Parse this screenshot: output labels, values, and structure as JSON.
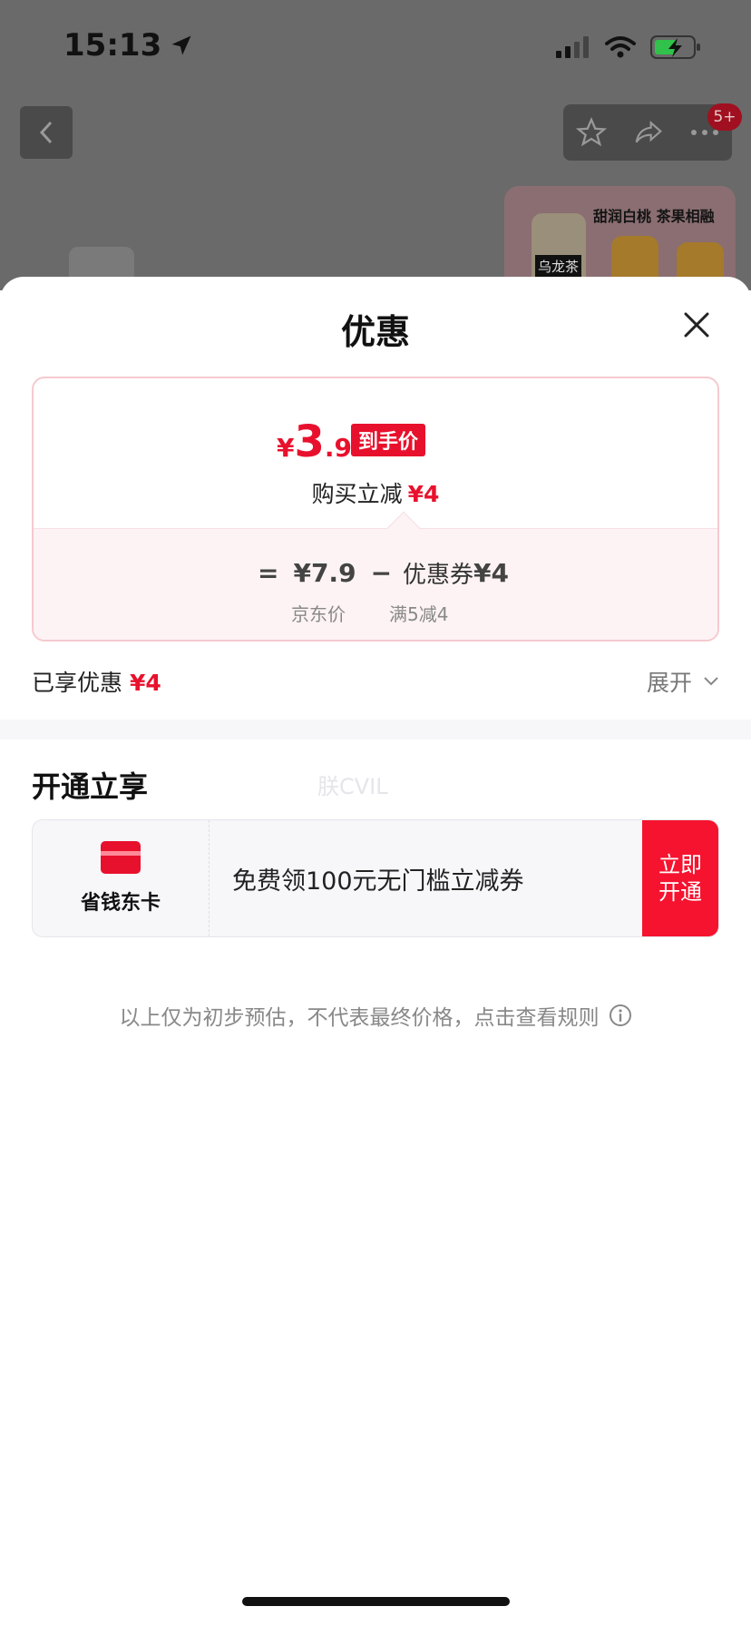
{
  "status_bar": {
    "time": "15:13"
  },
  "background": {
    "badge": "5+",
    "product_text": "甜润白桃 茶果相融",
    "bottle_label": "乌龙茶"
  },
  "sheet": {
    "title": "优惠",
    "price_card": {
      "yen": "¥",
      "price_int": "3",
      "price_dec": ".9",
      "final_tag": "到手价",
      "instant_label": "购买立减",
      "instant_amount": "¥4",
      "eq": "=",
      "jd_price": "¥7.9",
      "minus": "−",
      "coupon_label": "优惠券",
      "coupon_amount": "¥4",
      "jd_price_label": "京东价",
      "coupon_rule": "满5减4"
    },
    "enjoyed": {
      "label": "已享优惠",
      "amount": "¥4"
    },
    "expand_label": "展开",
    "section_title": "开通立享",
    "watermark": "朕CVIL",
    "member": {
      "name": "省钱东卡",
      "desc": "免费领100元无门槛立减券",
      "button_line1": "立即",
      "button_line2": "开通"
    },
    "disclaimer": "以上仅为初步预估，不代表最终价格，点击查看规则"
  },
  "colors": {
    "accent": "#e8112d",
    "card_border": "#f6c9cf"
  }
}
